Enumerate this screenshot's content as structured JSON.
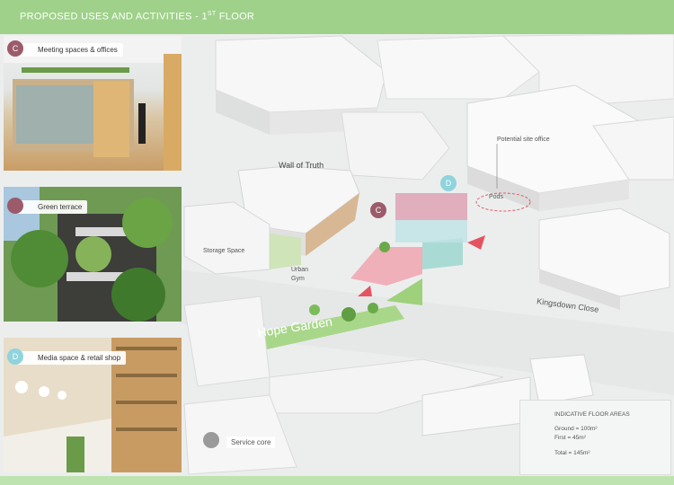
{
  "header": {
    "title": "PROPOSED USES AND ACTIVITIES - 1",
    "title_sup": "ST",
    "title_suffix": " FLOOR"
  },
  "legend": [
    {
      "letter": "C",
      "label": "Meeting spaces & offices",
      "color": "#9b5b6a"
    },
    {
      "letter": "",
      "label": "Green terrace",
      "color": "#9b5b6a"
    },
    {
      "letter": "D",
      "label": "Media space & retail shop",
      "color": "#8fd3dd"
    }
  ],
  "service_core": {
    "label": "Service core",
    "color": "#9a9a9a"
  },
  "map_labels": {
    "wall_of_truth": "Wall of Truth",
    "storage_space": "Storage Space",
    "urban_gym": "Urban\nGym",
    "potential_site_office": "Potential site office",
    "pods": "Pods",
    "kingsdown_close": "Kingsdown Close",
    "hope_garden": "Hope Garden"
  },
  "map_badges": {
    "c": "C",
    "d": "D"
  },
  "floor_areas": {
    "title": "INDICATIVE FLOOR AREAS",
    "ground": "Ground = 100m²",
    "first": "First = 45m²",
    "total": "Total = 145m²"
  }
}
